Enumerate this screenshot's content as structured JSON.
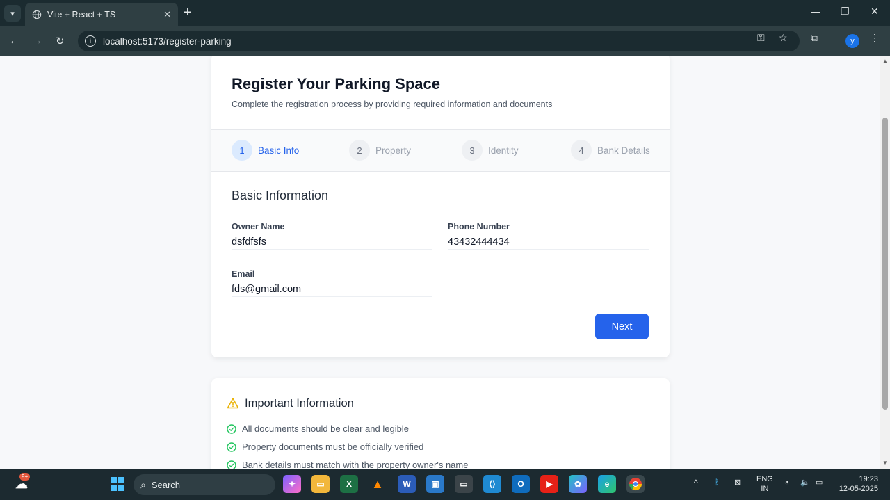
{
  "browser": {
    "tab_title": "Vite + React + TS",
    "url": "localhost:5173/register-parking",
    "profile_initial": "y"
  },
  "page": {
    "title": "Register Your Parking Space",
    "subtitle": "Complete the registration process by providing required information and documents",
    "steps": [
      {
        "number": "1",
        "label": "Basic Info",
        "active": true
      },
      {
        "number": "2",
        "label": "Property",
        "active": false
      },
      {
        "number": "3",
        "label": "Identity",
        "active": false
      },
      {
        "number": "4",
        "label": "Bank Details",
        "active": false
      }
    ],
    "section_title": "Basic Information",
    "fields": {
      "owner_name": {
        "label": "Owner Name",
        "value": "dsfdfsfs"
      },
      "phone": {
        "label": "Phone Number",
        "value": "43432444434"
      },
      "email": {
        "label": "Email",
        "value": "fds@gmail.com"
      }
    },
    "next_label": "Next",
    "info": {
      "title": "Important Information",
      "items": [
        "All documents should be clear and legible",
        "Property documents must be officially verified",
        "Bank details must match with the property owner's name"
      ]
    }
  },
  "taskbar": {
    "search_label": "Search",
    "notification_badge": "9+",
    "lang_line1": "ENG",
    "lang_line2": "IN",
    "time": "19:23",
    "date": "12-05-2025"
  },
  "colors": {
    "primary": "#2563eb",
    "chrome_dark": "#1b2b30",
    "chrome_toolbar": "#2f3f43",
    "success": "#22c55e",
    "warning": "#eab308"
  }
}
